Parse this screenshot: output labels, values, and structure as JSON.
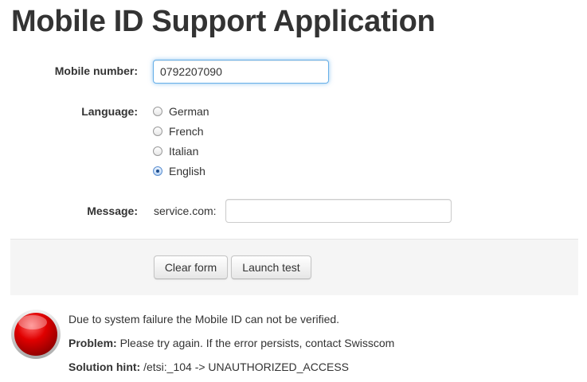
{
  "page": {
    "title": "Mobile ID Support Application"
  },
  "form": {
    "mobile_label": "Mobile number:",
    "mobile_value": "0792207090",
    "language_label": "Language:",
    "languages": [
      {
        "label": "German",
        "checked": false
      },
      {
        "label": "French",
        "checked": false
      },
      {
        "label": "Italian",
        "checked": false
      },
      {
        "label": "English",
        "checked": true
      }
    ],
    "message_label": "Message:",
    "message_prefix": "service.com:",
    "message_value": ""
  },
  "actions": {
    "clear_label": "Clear form",
    "launch_label": "Launch test"
  },
  "result": {
    "status_icon": "red-error-icon",
    "status_color": "#e00000",
    "message": "Due to system failure the Mobile ID can not be verified.",
    "problem_label": "Problem:",
    "problem_text": "Please try again. If the error persists, contact Swisscom",
    "hint_label": "Solution hint:",
    "hint_text": "/etsi:_104 -> UNAUTHORIZED_ACCESS"
  }
}
